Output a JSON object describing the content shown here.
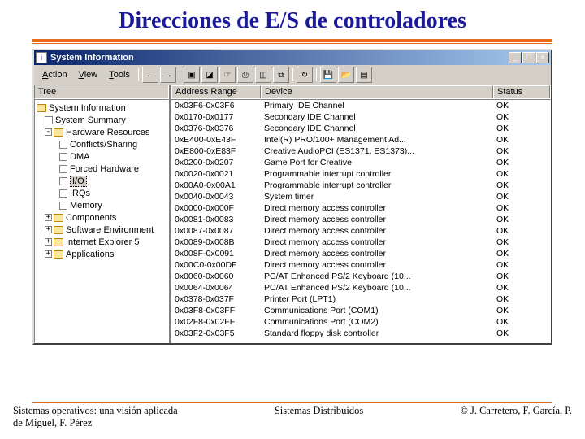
{
  "slide": {
    "title": "Direcciones de E/S de controladores"
  },
  "window": {
    "title": "System Information",
    "min": "_",
    "max": "□",
    "close": "×"
  },
  "menu": {
    "action": "Action",
    "view": "View",
    "tools": "Tools"
  },
  "left_header": "Tree",
  "tree": {
    "root": "System Information",
    "n1": "System Summary",
    "n2": "Hardware Resources",
    "n2a": "Conflicts/Sharing",
    "n2b": "DMA",
    "n2c": "Forced Hardware",
    "n2d": "I/O",
    "n2e": "IRQs",
    "n2f": "Memory",
    "n3": "Components",
    "n4": "Software Environment",
    "n5": "Internet Explorer 5",
    "n6": "Applications"
  },
  "columns": {
    "addr": "Address Range",
    "dev": "Device",
    "stat": "Status"
  },
  "rows": [
    {
      "a": "0x03F6-0x03F6",
      "d": "Primary IDE Channel",
      "s": "OK"
    },
    {
      "a": "0x0170-0x0177",
      "d": "Secondary IDE Channel",
      "s": "OK"
    },
    {
      "a": "0x0376-0x0376",
      "d": "Secondary IDE Channel",
      "s": "OK"
    },
    {
      "a": "0xE400-0xE43F",
      "d": "Intel(R) PRO/100+ Management Ad...",
      "s": "OK"
    },
    {
      "a": "0xE800-0xE83F",
      "d": "Creative AudioPCI (ES1371, ES1373)...",
      "s": "OK"
    },
    {
      "a": "0x0200-0x0207",
      "d": "Game Port for Creative",
      "s": "OK"
    },
    {
      "a": "0x0020-0x0021",
      "d": "Programmable interrupt controller",
      "s": "OK"
    },
    {
      "a": "0x00A0-0x00A1",
      "d": "Programmable interrupt controller",
      "s": "OK"
    },
    {
      "a": "0x0040-0x0043",
      "d": "System timer",
      "s": "OK"
    },
    {
      "a": "0x0000-0x000F",
      "d": "Direct memory access controller",
      "s": "OK"
    },
    {
      "a": "0x0081-0x0083",
      "d": "Direct memory access controller",
      "s": "OK"
    },
    {
      "a": "0x0087-0x0087",
      "d": "Direct memory access controller",
      "s": "OK"
    },
    {
      "a": "0x0089-0x008B",
      "d": "Direct memory access controller",
      "s": "OK"
    },
    {
      "a": "0x008F-0x0091",
      "d": "Direct memory access controller",
      "s": "OK"
    },
    {
      "a": "0x00C0-0x00DF",
      "d": "Direct memory access controller",
      "s": "OK"
    },
    {
      "a": "0x0060-0x0060",
      "d": "PC/AT Enhanced PS/2 Keyboard (10...",
      "s": "OK"
    },
    {
      "a": "0x0064-0x0064",
      "d": "PC/AT Enhanced PS/2 Keyboard (10...",
      "s": "OK"
    },
    {
      "a": "0x0378-0x037F",
      "d": "Printer Port (LPT1)",
      "s": "OK"
    },
    {
      "a": "0x03F8-0x03FF",
      "d": "Communications Port (COM1)",
      "s": "OK"
    },
    {
      "a": "0x02F8-0x02FF",
      "d": "Communications Port (COM2)",
      "s": "OK"
    },
    {
      "a": "0x03F2-0x03F5",
      "d": "Standard floppy disk controller",
      "s": "OK"
    }
  ],
  "footer": {
    "left": "Sistemas operativos: una visión aplicada\nde Miguel, F. Pérez",
    "center": "Sistemas Distribuidos",
    "right": "© J. Carretero, F. García, P."
  }
}
